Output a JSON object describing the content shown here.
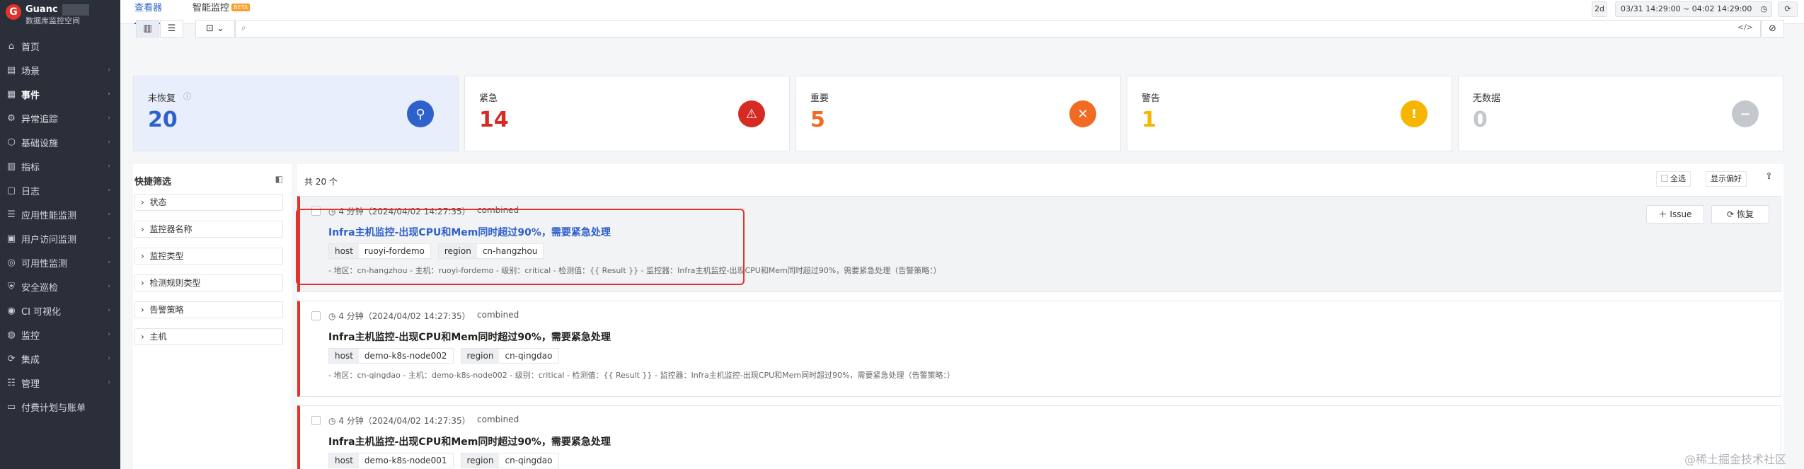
{
  "brand": {
    "name": "Guanc",
    "subtitle": "数据库监控空间"
  },
  "sidebar": {
    "items": [
      {
        "label": "首页",
        "icon": "home-icon",
        "glyph": "⌂",
        "arrow": false
      },
      {
        "label": "场景",
        "icon": "scene-icon",
        "glyph": "▤",
        "arrow": true
      },
      {
        "label": "事件",
        "icon": "event-icon",
        "glyph": "▦",
        "arrow": true,
        "active": true
      },
      {
        "label": "异常追踪",
        "icon": "anomaly-icon",
        "glyph": "⚙",
        "arrow": true
      },
      {
        "label": "基础设施",
        "icon": "infra-icon",
        "glyph": "⬡",
        "arrow": true
      },
      {
        "label": "指标",
        "icon": "metric-icon",
        "glyph": "▥",
        "arrow": true
      },
      {
        "label": "日志",
        "icon": "log-icon",
        "glyph": "▢",
        "arrow": true
      },
      {
        "label": "应用性能监测",
        "icon": "apm-icon",
        "glyph": "☰",
        "arrow": true
      },
      {
        "label": "用户访问监测",
        "icon": "rum-icon",
        "glyph": "▣",
        "arrow": true
      },
      {
        "label": "可用性监测",
        "icon": "availability-icon",
        "glyph": "◎",
        "arrow": true
      },
      {
        "label": "安全巡检",
        "icon": "security-icon",
        "glyph": "⛨",
        "arrow": true
      },
      {
        "label": "CI 可视化",
        "icon": "ci-icon",
        "glyph": "◉",
        "arrow": true
      },
      {
        "label": "监控",
        "icon": "monitor-icon",
        "glyph": "◍",
        "arrow": true
      },
      {
        "label": "集成",
        "icon": "integration-icon",
        "glyph": "⟳",
        "arrow": true
      },
      {
        "label": "管理",
        "icon": "settings-icon",
        "glyph": "☷",
        "arrow": true
      },
      {
        "label": "付费计划与账单",
        "icon": "billing-icon",
        "glyph": "▭",
        "arrow": false
      }
    ]
  },
  "tabs": [
    {
      "label": "查看器",
      "active": true
    },
    {
      "label": "智能监控",
      "badge": "BETA"
    }
  ],
  "time": {
    "range_short": "2d",
    "range": "03/31 14:29:00 ~ 04:02 14:29:00"
  },
  "colors": {
    "critical": "#e4332b",
    "error": "#f26b25",
    "warning": "#f7b500",
    "nodata": "#c4c7cc",
    "recover": "#2f61cc"
  },
  "stats": [
    {
      "label": "未恢复",
      "value": "20",
      "color": "#2f61cc",
      "icon": "wrench-icon",
      "glyph": "⚲"
    },
    {
      "label": "紧急",
      "value": "14",
      "color": "#d62b22",
      "icon": "alarm-icon",
      "glyph": "⚠"
    },
    {
      "label": "重要",
      "value": "5",
      "color": "#f26b25",
      "icon": "x-circle-icon",
      "glyph": "✕"
    },
    {
      "label": "警告",
      "value": "1",
      "color": "#f7b500",
      "icon": "exclamation-icon",
      "glyph": "!"
    },
    {
      "label": "无数据",
      "value": "0",
      "color": "#c4c7cc",
      "icon": "minus-icon",
      "glyph": "−"
    }
  ],
  "filter": {
    "title": "快捷筛选",
    "items": [
      "状态",
      "监控器名称",
      "监控类型",
      "检测规则类型",
      "告警策略",
      "主机"
    ]
  },
  "list": {
    "total": "共 20 个",
    "select_all": "全选",
    "display_pref": "显示偏好",
    "add_issue": "Issue",
    "recover": "恢复",
    "events": [
      {
        "time": "4 分钟（2024/04/02 14:27:35）",
        "type": "combined",
        "title": "Infra主机监控-出现CPU和Mem同时超过90%，需要紧急处理",
        "tags": [
          {
            "k": "host",
            "v": "ruoyi-fordemo"
          },
          {
            "k": "region",
            "v": "cn-hangzhou"
          }
        ],
        "desc": "- 地区：cn-hangzhou - 主机：ruoyi-fordemo - 级别：critical - 检测值：{{ Result }} - 监控器：Infra主机监控-出现CPU和Mem同时超过90%，需要紧急处理（告警策略：）"
      },
      {
        "time": "4 分钟（2024/04/02 14:27:35）",
        "type": "combined",
        "title": "Infra主机监控-出现CPU和Mem同时超过90%，需要紧急处理",
        "tags": [
          {
            "k": "host",
            "v": "demo-k8s-node002"
          },
          {
            "k": "region",
            "v": "cn-qingdao"
          }
        ],
        "desc": "- 地区：cn-qingdao - 主机：demo-k8s-node002 - 级别：critical - 检测值：{{ Result }} - 监控器：Infra主机监控-出现CPU和Mem同时超过90%，需要紧急处理（告警策略：）"
      },
      {
        "time": "4 分钟（2024/04/02 14:27:35）",
        "type": "combined",
        "title": "Infra主机监控-出现CPU和Mem同时超过90%，需要紧急处理",
        "tags": [
          {
            "k": "host",
            "v": "demo-k8s-node001"
          },
          {
            "k": "region",
            "v": "cn-qingdao"
          }
        ],
        "desc": ""
      }
    ]
  },
  "watermark": "@稀土掘金技术社区"
}
